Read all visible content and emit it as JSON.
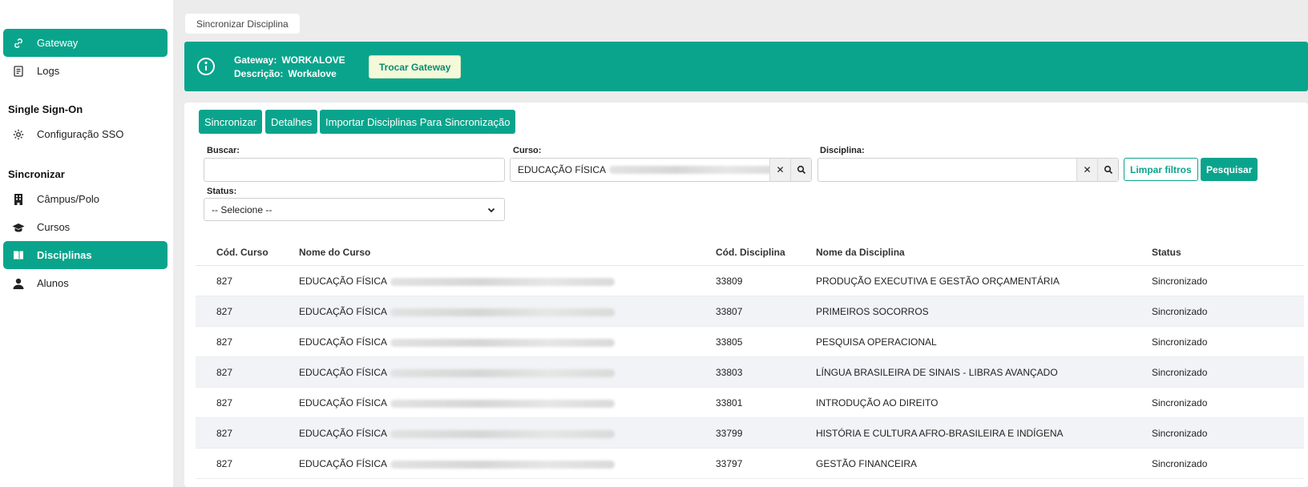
{
  "sidebar": {
    "items": [
      {
        "label": "Gateway",
        "icon": "link-icon",
        "active": true
      },
      {
        "label": "Logs",
        "icon": "logs-icon",
        "active": false
      }
    ],
    "sso_section": "Single Sign-On",
    "sso_items": [
      {
        "label": "Configuração SSO",
        "icon": "gear-icon"
      }
    ],
    "sync_section": "Sincronizar",
    "sync_items": [
      {
        "label": "Câmpus/Polo",
        "icon": "building-icon",
        "active": false
      },
      {
        "label": "Cursos",
        "icon": "graduation-cap-icon",
        "active": false
      },
      {
        "label": "Disciplinas",
        "icon": "book-icon",
        "active": true
      },
      {
        "label": "Alunos",
        "icon": "user-icon",
        "active": false
      }
    ]
  },
  "breadcrumb": "Sincronizar Disciplina",
  "banner": {
    "gateway_label": "Gateway:",
    "gateway_value": "WORKALOVE",
    "descricao_label": "Descrição:",
    "descricao_value": "Workalove",
    "trocar_button": "Trocar Gateway",
    "color": "#0aa48c"
  },
  "toolbar": {
    "sincronizar": "Sincronizar",
    "detalhes": "Detalhes",
    "importar": "Importar Disciplinas Para Sincronização"
  },
  "filters": {
    "buscar_label": "Buscar:",
    "buscar_value": "",
    "curso_label": "Curso:",
    "curso_value": "EDUCAÇÃO FÍSICA",
    "disciplina_label": "Disciplina:",
    "disciplina_value": "",
    "status_label": "Status:",
    "status_value": "-- Selecione --",
    "limpar": "Limpar filtros",
    "pesquisar": "Pesquisar"
  },
  "table": {
    "headers": [
      "Cód. Curso",
      "Nome do Curso",
      "Cód. Disciplina",
      "Nome da Disciplina",
      "Status"
    ],
    "rows": [
      {
        "cod_curso": "827",
        "nome_curso": "EDUCAÇÃO FÍSICA",
        "cod_disc": "33809",
        "nome_disc": "PRODUÇÃO EXECUTIVA E GESTÃO ORÇAMENTÁRIA",
        "status": "Sincronizado"
      },
      {
        "cod_curso": "827",
        "nome_curso": "EDUCAÇÃO FÍSICA",
        "cod_disc": "33807",
        "nome_disc": "PRIMEIROS SOCORROS",
        "status": "Sincronizado"
      },
      {
        "cod_curso": "827",
        "nome_curso": "EDUCAÇÃO FÍSICA",
        "cod_disc": "33805",
        "nome_disc": "PESQUISA OPERACIONAL",
        "status": "Sincronizado"
      },
      {
        "cod_curso": "827",
        "nome_curso": "EDUCAÇÃO FÍSICA",
        "cod_disc": "33803",
        "nome_disc": "LÍNGUA BRASILEIRA DE SINAIS - LIBRAS AVANÇADO",
        "status": "Sincronizado"
      },
      {
        "cod_curso": "827",
        "nome_curso": "EDUCAÇÃO FÍSICA",
        "cod_disc": "33801",
        "nome_disc": "INTRODUÇÃO AO DIREITO",
        "status": "Sincronizado"
      },
      {
        "cod_curso": "827",
        "nome_curso": "EDUCAÇÃO FÍSICA",
        "cod_disc": "33799",
        "nome_disc": "HISTÓRIA E CULTURA AFRO-BRASILEIRA E INDÍGENA",
        "status": "Sincronizado"
      },
      {
        "cod_curso": "827",
        "nome_curso": "EDUCAÇÃO FÍSICA",
        "cod_disc": "33797",
        "nome_disc": "GESTÃO FINANCEIRA",
        "status": "Sincronizado"
      }
    ]
  }
}
